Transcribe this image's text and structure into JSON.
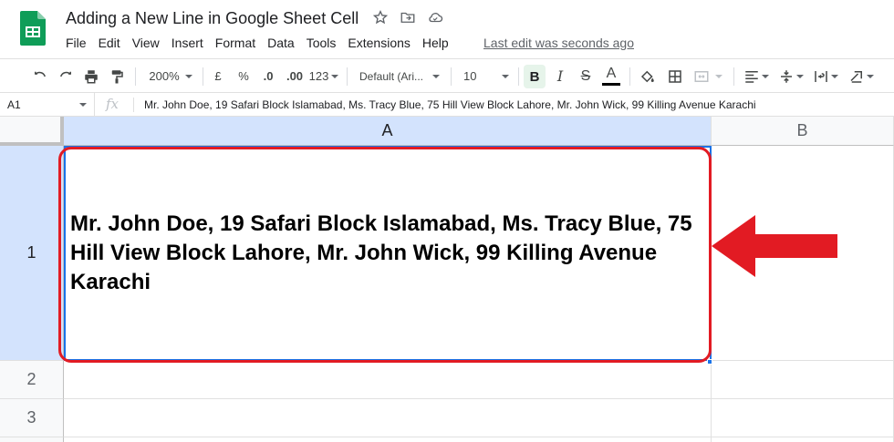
{
  "document": {
    "title": "Adding a New Line in Google Sheet Cell",
    "last_edit": "Last edit was seconds ago"
  },
  "menu": [
    "File",
    "Edit",
    "View",
    "Insert",
    "Format",
    "Data",
    "Tools",
    "Extensions",
    "Help"
  ],
  "toolbar": {
    "zoom": "200%",
    "currency": "£",
    "percent": "%",
    "decrease_decimal": ".0",
    "increase_decimal": ".00",
    "number_format": "123",
    "font_family": "Default (Ari...",
    "font_size": "10",
    "bold": "B",
    "italic": "I",
    "strikethrough": "S",
    "text_color": "A"
  },
  "formula_bar": {
    "cell_ref": "A1",
    "fx": "fx",
    "content": "Mr. John Doe, 19 Safari Block Islamabad, Ms. Tracy Blue, 75 Hill View Block Lahore, Mr. John Wick, 99 Killing Avenue Karachi"
  },
  "grid": {
    "columns": [
      "A",
      "B"
    ],
    "rows": [
      "1",
      "2",
      "3"
    ],
    "cell_a1": "Mr. John Doe, 19 Safari Block Islamabad, Ms. Tracy Blue, 75 Hill View Block Lahore, Mr. John Wick, 99 Killing Avenue Karachi"
  },
  "colors": {
    "annotation_red": "#e21b23",
    "selection_blue": "#1a73e8",
    "sheets_green": "#0f9d58",
    "bold_active_bg": "#e6f4ea"
  }
}
